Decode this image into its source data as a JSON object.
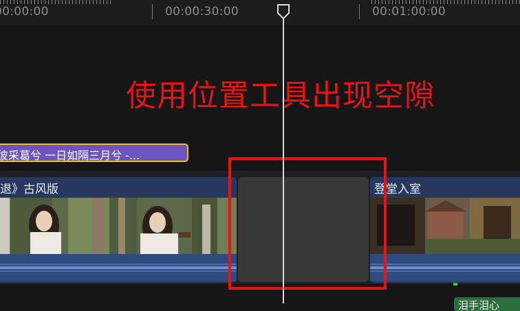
{
  "ruler": {
    "timecodes": [
      "00:00:00",
      "00:00:30:00",
      "00:01:00:00"
    ]
  },
  "overlay": {
    "title": "使用位置工具出现空隙",
    "color": "#ee1111"
  },
  "timeline": {
    "title_clip": {
      "label": "彼采葛兮 一日如隔三月兮 -...",
      "color": "#6d55bd",
      "selected_border": "#f0c020"
    },
    "clip_left": {
      "label": "退》古风版",
      "color": "#26385e"
    },
    "gap": {
      "color": "#383838"
    },
    "clip_right": {
      "label": "登堂入室",
      "color": "#26385e"
    },
    "audio_clip": {
      "label": "泪手泪心",
      "color": "#2c6d3e"
    }
  },
  "icons": {
    "playhead": "playhead-handle-icon"
  }
}
